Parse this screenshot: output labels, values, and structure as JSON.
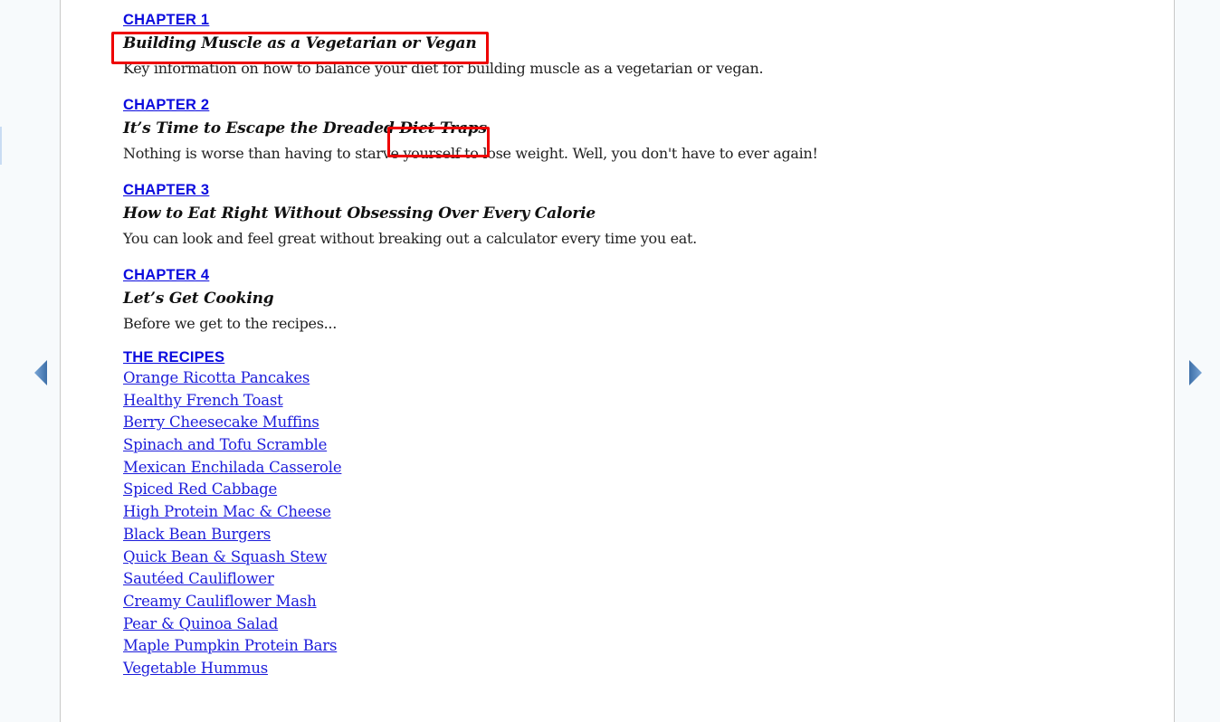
{
  "navigation": {
    "prev_icon": "triangle-left-icon",
    "next_icon": "triangle-right-icon",
    "arrow_color": "#4a7db6"
  },
  "chapters": [
    {
      "label": "CHAPTER 1",
      "title": "Building Muscle as a Vegetarian or Vegan",
      "description": "Key information on how to balance your diet for building muscle as a vegetarian or vegan."
    },
    {
      "label": "CHAPTER 2",
      "title_part1": "It’s Time to Escape the Dreaded",
      "title_part2": "Diet Traps",
      "description": "Nothing is worse than having to starve yourself to lose weight. Well, you don't have to ever again!"
    },
    {
      "label": "CHAPTER 3",
      "title": "How to Eat Right Without Obsessing Over Every Calorie",
      "description": "You can look and feel great without breaking out a calculator every time you eat."
    },
    {
      "label": "CHAPTER 4",
      "title": "Let’s Get Cooking",
      "description": "Before we get to the recipes..."
    }
  ],
  "recipes": {
    "heading": "THE RECIPES",
    "items": [
      "Orange Ricotta Pancakes",
      "Healthy French Toast",
      "Berry Cheesecake Muffins",
      "Spinach and Tofu Scramble",
      "Mexican Enchilada Casserole",
      "Spiced Red Cabbage",
      "High Protein Mac & Cheese",
      "Black Bean Burgers",
      "Quick Bean & Squash Stew",
      "Sautéed Cauliflower",
      "Creamy Cauliflower Mash",
      "Pear & Quinoa Salad",
      "Maple Pumpkin Protein Bars",
      "Vegetable Hummus"
    ]
  },
  "highlights": {
    "color": "#ee0000",
    "targets": [
      "chapter-1-title",
      "chapter-2-title-diet-traps"
    ]
  }
}
